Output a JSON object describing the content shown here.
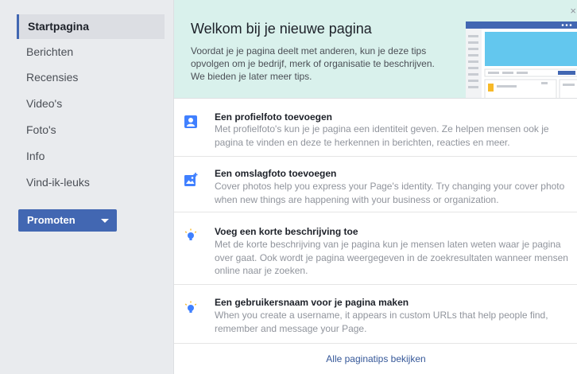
{
  "sidebar": {
    "items": [
      {
        "label": "Startpagina",
        "active": true
      },
      {
        "label": "Berichten"
      },
      {
        "label": "Recensies"
      },
      {
        "label": "Video's"
      },
      {
        "label": "Foto's"
      },
      {
        "label": "Info"
      },
      {
        "label": "Vind-ik-leuks"
      }
    ],
    "promote_label": "Promoten"
  },
  "welcome": {
    "title": "Welkom bij je nieuwe pagina",
    "text": "Voordat je je pagina deelt met anderen, kun je deze tips opvolgen om je bedrijf, merk of organisatie te beschrijven. We bieden je later meer tips.",
    "close": "×"
  },
  "tips": [
    {
      "icon": "profile-photo-icon",
      "title": "Een profielfoto toevoegen",
      "desc": "Met profielfoto's kun je je pagina een identiteit geven. Ze helpen mensen ook je pagina te vinden en deze te herkennen in berichten, reacties en meer."
    },
    {
      "icon": "cover-photo-icon",
      "title": "Een omslagfoto toevoegen",
      "desc": "Cover photos help you express your Page's identity. Try changing your cover photo when new things are happening with your business or organization."
    },
    {
      "icon": "lightbulb-icon",
      "title": "Voeg een korte beschrijving toe",
      "desc": "Met de korte beschrijving van je pagina kun je mensen laten weten waar je pagina over gaat. Ook wordt je pagina weergegeven in de zoekresultaten wanneer mensen online naar je zoeken."
    },
    {
      "icon": "lightbulb-icon",
      "title": "Een gebruikersnaam voor je pagina maken",
      "desc": "When you create a username, it appears in custom URLs that help people find, remember and message your Page."
    }
  ],
  "all_tips_link": "Alle paginatips bekijken",
  "colors": {
    "accent": "#4267b2",
    "welcome_bg": "#d9f1ec",
    "icon_blue": "#4080ff"
  }
}
